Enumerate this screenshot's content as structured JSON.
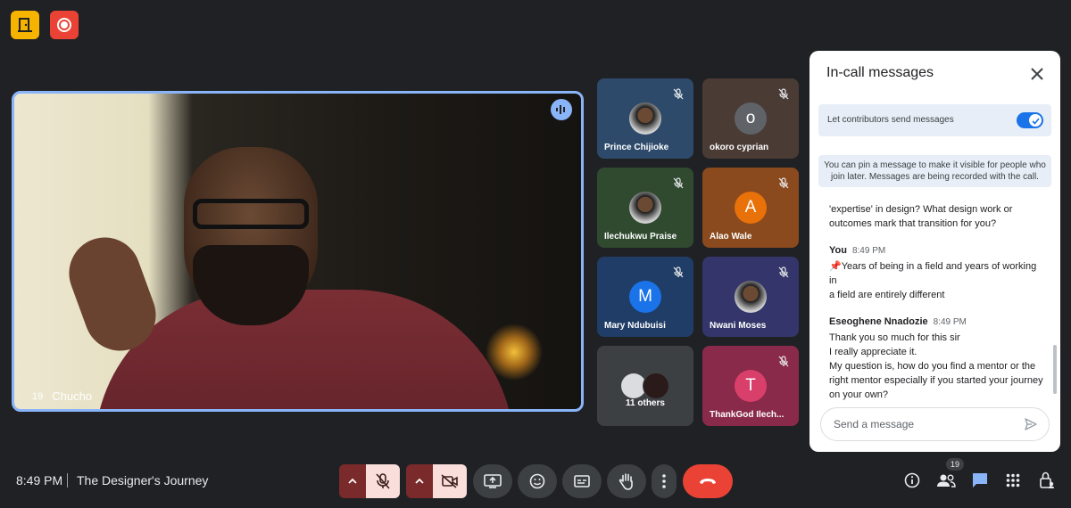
{
  "meeting": {
    "time": "8:49 PM",
    "title": "The Designer's Journey",
    "people_count": "19"
  },
  "speaker": {
    "name": "Chucho",
    "pin_label": "19"
  },
  "tiles": [
    {
      "name": "Prince Chijioke",
      "avatar": "",
      "bg": "#2d4a6b"
    },
    {
      "name": "okoro cyprian",
      "avatar": "o",
      "bg": "#4a3b35"
    },
    {
      "name": "Ilechukwu Praise",
      "avatar": "",
      "bg": "#2f4a2f"
    },
    {
      "name": "Alao Wale",
      "avatar": "A",
      "bg": "#8a4a1e"
    },
    {
      "name": "Mary Ndubuisi",
      "avatar": "M",
      "bg": "#1f3d66"
    },
    {
      "name": "Nwani Moses",
      "avatar": "",
      "bg": "#34366b"
    },
    {
      "name": "11 others",
      "avatar": "",
      "bg": "#3c4043"
    },
    {
      "name": "ThankGod Ilech...",
      "avatar": "T",
      "bg": "#8a2a4a"
    }
  ],
  "chat": {
    "title": "In-call messages",
    "toggle_label": "Let contributors send messages",
    "info_line1": "You can pin a message to make it visible for people who",
    "info_line2": "join later. Messages are being recorded with the call.",
    "partial_line1": "'expertise' in design? What design work or",
    "partial_line2": "outcomes mark that transition for you?",
    "msg1_sender": "You",
    "msg1_time": "8:49 PM",
    "msg1_line1": "📌Years of being in a field and years of working in",
    "msg1_line2": "a field are entirely different",
    "msg2_sender": "Eseoghene Nnadozie",
    "msg2_time": "8:49 PM",
    "msg2_line1": "Thank you so much for this sir",
    "msg2_line2": "I really appreciate it.",
    "msg2_line3": "My question is, how do you find a mentor or the",
    "msg2_line4": "right mentor especially if you started your journey",
    "msg2_line5": "on your own?",
    "input_placeholder": "Send a message"
  },
  "colors": {
    "accent": "#8ab4f8",
    "end_call": "#ea4335",
    "toggle": "#1a73e8"
  }
}
